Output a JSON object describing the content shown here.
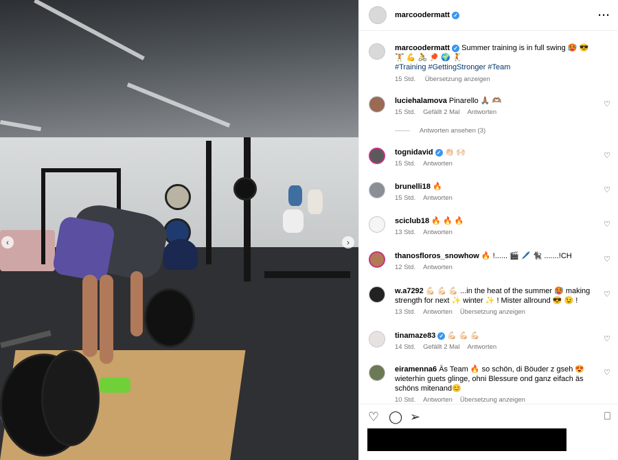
{
  "post": {
    "author": "marcoodermatt",
    "caption": {
      "text": "Summer training is in full swing 🥵 😎 🏋 💪 🚴 🏓 🌍 🤾",
      "hashtags": "#Training #GettingStronger #Team",
      "time": "15 Std.",
      "translate": "Übersetzung anzeigen"
    },
    "comments": [
      {
        "user": "luciehalamova",
        "text": "Pinarello 🙏🏽 🫶🏽",
        "time": "15 Std.",
        "likes": "Gefällt 2 Mal",
        "reply": "Antworten"
      },
      {
        "user": "tognidavid",
        "verified": true,
        "text": "👏🏻 🙌🏻",
        "time": "15 Std.",
        "reply": "Antworten"
      },
      {
        "user": "brunelli18",
        "text": "🔥",
        "time": "15 Std.",
        "reply": "Antworten"
      },
      {
        "user": "sciclub18",
        "text": "🔥 🔥 🔥",
        "time": "13 Std.",
        "reply": "Antworten"
      },
      {
        "user": "thanosfloros_snowhow",
        "text": "🔥 !...... 🎬 🖊️ 🐈‍⬛ .......!CH",
        "time": "12 Std.",
        "reply": "Antworten"
      },
      {
        "user": "w.a7292",
        "text": "💪🏻 💪🏻 💪🏻 ...in the heat of the summer 🥵 making strength for next ✨ winter ✨ ! Mister allround 😎 😉 !",
        "time": "13 Std.",
        "reply": "Antworten",
        "translate": "Übersetzung anzeigen"
      },
      {
        "user": "tinamaze83",
        "verified": true,
        "text": "💪🏻 💪🏻 💪🏻",
        "time": "14 Std.",
        "likes": "Gefällt 2 Mal",
        "reply": "Antworten"
      },
      {
        "user": "eiramenna6",
        "text": "Äs Team 🔥 so schön, di Böuder z gseh 😍 wieterhin guets glinge, ohni Blessure ond ganz eifach äs schöns mitenand😊",
        "time": "10 Std.",
        "reply": "Antworten",
        "translate": "Übersetzung anzeigen"
      }
    ],
    "view_replies": "Antworten ansehen (3)"
  },
  "icons": {
    "heart": "heart-icon",
    "comment": "comment-icon",
    "share": "share-icon",
    "save": "bookmark-icon",
    "more": "more-icon"
  },
  "colors": {
    "verified": "#3897f0",
    "hashtag": "#00376b",
    "meta": "#737373"
  }
}
